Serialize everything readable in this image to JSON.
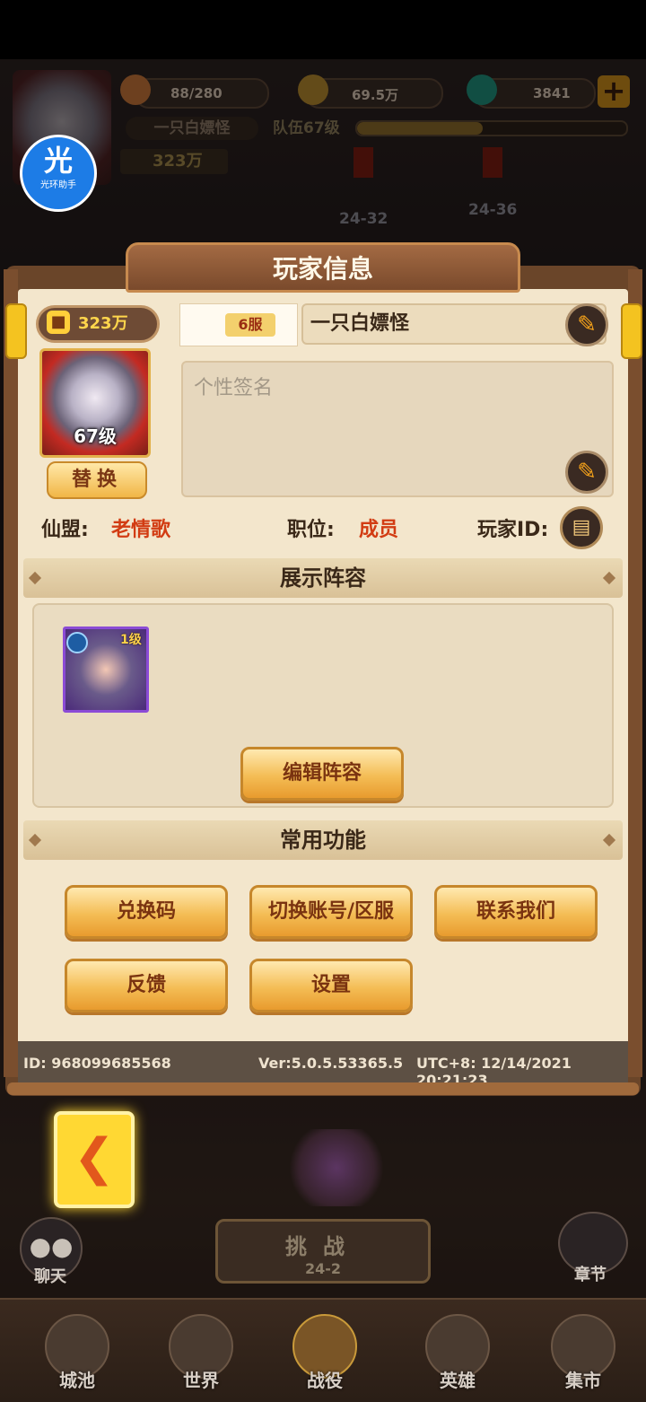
{
  "top_bar": {
    "stamina": "88/280",
    "coins": "69.5万",
    "gems": "3841",
    "plus_icon": "plus-icon",
    "player_name": "一只白嫖怪",
    "team_level": "队伍67级",
    "power": "323万",
    "stage_a": "24-32",
    "stage_b": "24-36"
  },
  "overlay_badge": {
    "big": "光",
    "small": "光环助手"
  },
  "panel": {
    "title": "玩家信息",
    "power": "323万",
    "server": "6服",
    "name": "一只白嫖怪",
    "avatar_level": "67级",
    "swap_button": "替换",
    "signature_placeholder": "个性签名",
    "alliance_label": "仙盟:",
    "alliance_value": "老情歌",
    "position_label": "职位:",
    "position_value": "成员",
    "player_id_label": "玩家ID:",
    "lineup_section": "展示阵容",
    "hero_level": "1级",
    "edit_lineup_button": "编辑阵容",
    "functions_section": "常用功能",
    "buttons": {
      "redeem": "兑换码",
      "switch": "切换账号/区服",
      "contact": "联系我们",
      "feedback": "反馈",
      "settings": "设置"
    },
    "footer": {
      "id": "ID:  968099685568",
      "version": "Ver:5.0.5.53365.5",
      "time": "UTC+8:  12/14/2021 20:21:23"
    }
  },
  "game_ui": {
    "chat_label": "聊天",
    "challenge_title": "挑战",
    "challenge_stage": "24-2",
    "chapter_label": "章节"
  },
  "bottom_nav": [
    "城池",
    "世界",
    "战役",
    "英雄",
    "集市"
  ],
  "colors": {
    "accent_red": "#d23c13",
    "button_gold": "#f4bd55",
    "panel_bg": "#f3e6cc"
  }
}
